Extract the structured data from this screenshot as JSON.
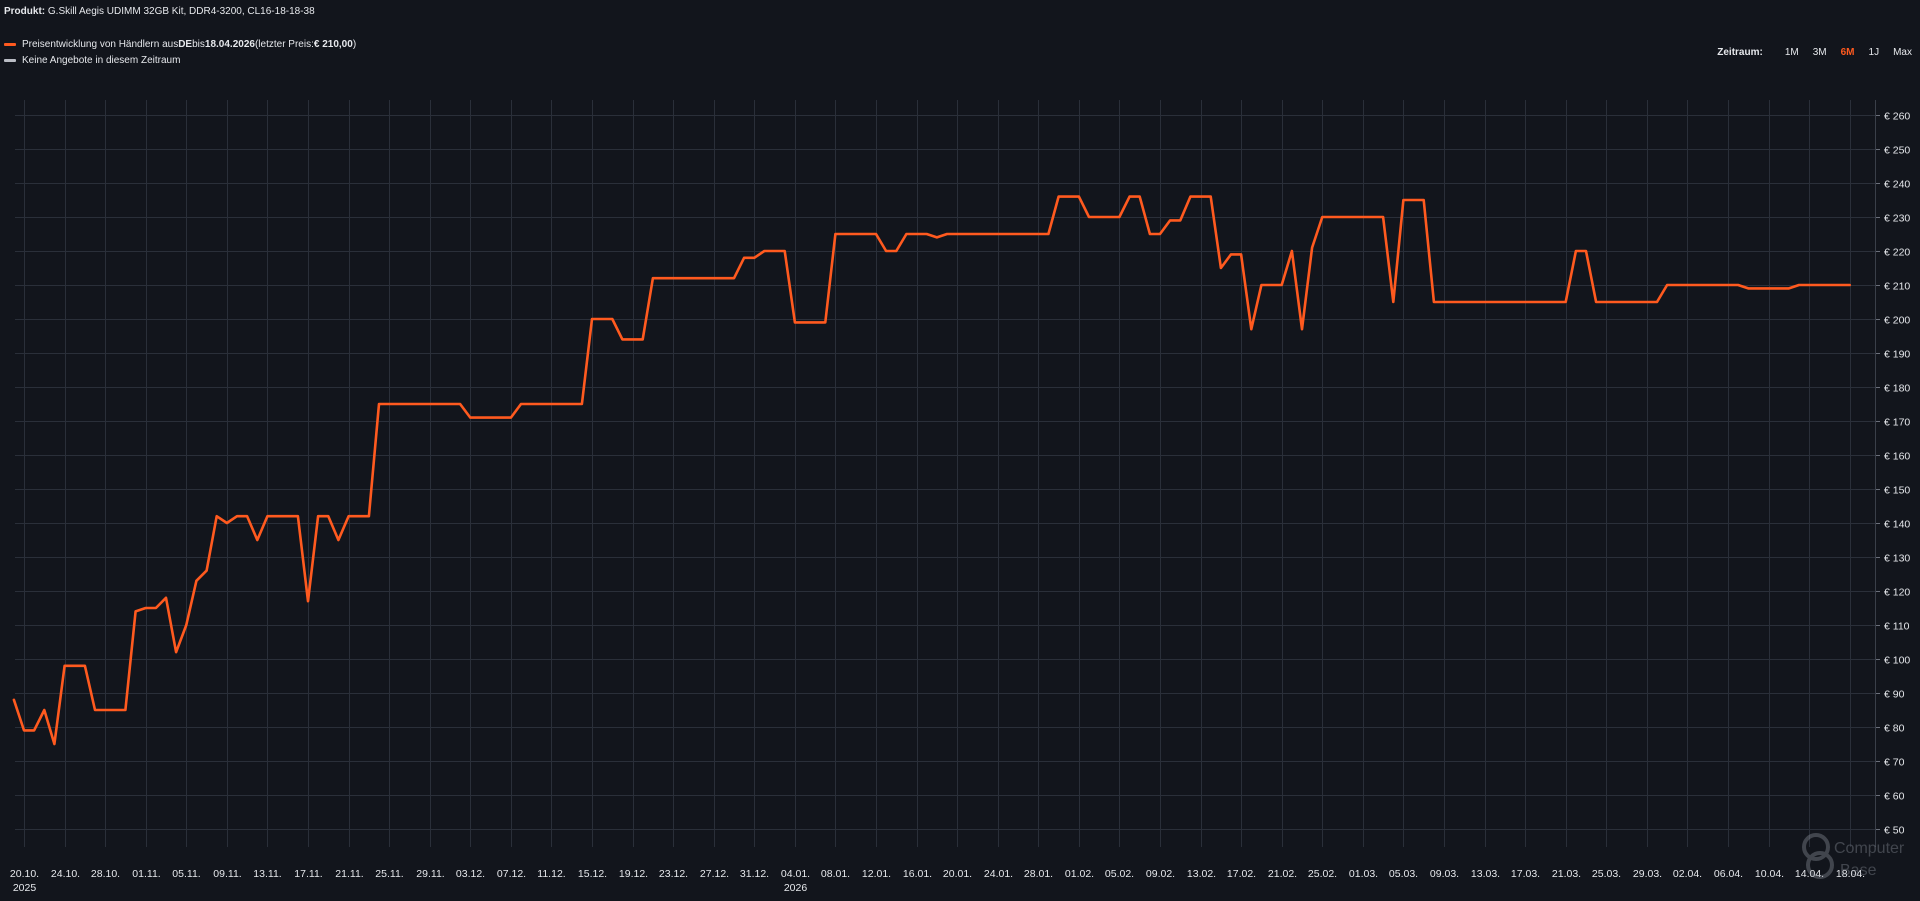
{
  "header": {
    "product_label": "Produkt:",
    "product_name": "G.Skill Aegis UDIMM 32GB Kit, DDR4-3200, CL16-18-18-38"
  },
  "legend": {
    "items": [
      {
        "color": "#ff5a1f",
        "text_prefix": "Preisentwicklung von Händlern aus ",
        "country": "DE",
        "text_mid": " bis ",
        "date": "18.04.2026",
        "text_last": " (letzter Preis: ",
        "last_price": "€ 210,00",
        "text_end": ")"
      },
      {
        "color": "#b9bcc4",
        "text": "Keine Angebote in diesem Zeitraum"
      }
    ]
  },
  "range": {
    "label": "Zeitraum:",
    "options": [
      "1M",
      "3M",
      "6M",
      "1J",
      "Max"
    ],
    "active": "6M",
    "active_color": "#ff5a1f"
  },
  "watermark": {
    "text1": "Computer",
    "text2": "Base"
  },
  "chart_data": {
    "type": "line",
    "xlabel": "",
    "ylabel": "",
    "ylim": [
      45,
      265
    ],
    "xlim": [
      "2025-10-20",
      "2026-04-20"
    ],
    "y_ticks": [
      50,
      60,
      70,
      80,
      90,
      100,
      110,
      120,
      130,
      140,
      150,
      160,
      170,
      180,
      190,
      200,
      210,
      220,
      230,
      240,
      250,
      260
    ],
    "y_tick_labels": [
      "€ 50",
      "€ 60",
      "€ 70",
      "€ 80",
      "€ 90",
      "€ 100",
      "€ 110",
      "€ 120",
      "€ 130",
      "€ 140",
      "€ 150",
      "€ 160",
      "€ 170",
      "€ 180",
      "€ 190",
      "€ 200",
      "€ 210",
      "€ 220",
      "€ 230",
      "€ 240",
      "€ 250",
      "€ 260"
    ],
    "x_ticks": [
      {
        "date": "2025-10-20",
        "label": "20.10.",
        "year": "2025"
      },
      {
        "date": "2025-10-24",
        "label": "24.10."
      },
      {
        "date": "2025-10-28",
        "label": "28.10."
      },
      {
        "date": "2025-11-01",
        "label": "01.11."
      },
      {
        "date": "2025-11-05",
        "label": "05.11."
      },
      {
        "date": "2025-11-09",
        "label": "09.11."
      },
      {
        "date": "2025-11-13",
        "label": "13.11."
      },
      {
        "date": "2025-11-17",
        "label": "17.11."
      },
      {
        "date": "2025-11-21",
        "label": "21.11."
      },
      {
        "date": "2025-11-25",
        "label": "25.11."
      },
      {
        "date": "2025-11-29",
        "label": "29.11."
      },
      {
        "date": "2025-12-03",
        "label": "03.12."
      },
      {
        "date": "2025-12-07",
        "label": "07.12."
      },
      {
        "date": "2025-12-11",
        "label": "11.12."
      },
      {
        "date": "2025-12-15",
        "label": "15.12."
      },
      {
        "date": "2025-12-19",
        "label": "19.12."
      },
      {
        "date": "2025-12-23",
        "label": "23.12."
      },
      {
        "date": "2025-12-27",
        "label": "27.12."
      },
      {
        "date": "2025-12-31",
        "label": "31.12."
      },
      {
        "date": "2026-01-04",
        "label": "04.01.",
        "year": "2026"
      },
      {
        "date": "2026-01-08",
        "label": "08.01."
      },
      {
        "date": "2026-01-12",
        "label": "12.01."
      },
      {
        "date": "2026-01-16",
        "label": "16.01."
      },
      {
        "date": "2026-01-20",
        "label": "20.01."
      },
      {
        "date": "2026-01-24",
        "label": "24.01."
      },
      {
        "date": "2026-01-28",
        "label": "28.01."
      },
      {
        "date": "2026-02-01",
        "label": "01.02."
      },
      {
        "date": "2026-02-05",
        "label": "05.02."
      },
      {
        "date": "2026-02-09",
        "label": "09.02."
      },
      {
        "date": "2026-02-13",
        "label": "13.02."
      },
      {
        "date": "2026-02-17",
        "label": "17.02."
      },
      {
        "date": "2026-02-21",
        "label": "21.02."
      },
      {
        "date": "2026-02-25",
        "label": "25.02."
      },
      {
        "date": "2026-03-01",
        "label": "01.03."
      },
      {
        "date": "2026-03-05",
        "label": "05.03."
      },
      {
        "date": "2026-03-09",
        "label": "09.03."
      },
      {
        "date": "2026-03-13",
        "label": "13.03."
      },
      {
        "date": "2026-03-17",
        "label": "17.03."
      },
      {
        "date": "2026-03-21",
        "label": "21.03."
      },
      {
        "date": "2026-03-25",
        "label": "25.03."
      },
      {
        "date": "2026-03-29",
        "label": "29.03."
      },
      {
        "date": "2026-04-02",
        "label": "02.04."
      },
      {
        "date": "2026-04-06",
        "label": "06.04."
      },
      {
        "date": "2026-04-10",
        "label": "10.04."
      },
      {
        "date": "2026-04-14",
        "label": "14.04."
      },
      {
        "date": "2026-04-18",
        "label": "18.04."
      }
    ],
    "grid": true,
    "series": [
      {
        "color": "#ff5a1f",
        "points": [
          [
            "2025-10-19T00:00",
            88
          ],
          [
            "2025-10-20T00:00",
            79
          ],
          [
            "2025-10-21T00:00",
            79
          ],
          [
            "2025-10-22T00:00",
            85
          ],
          [
            "2025-10-23T00:00",
            75
          ],
          [
            "2025-10-24T00:00",
            98
          ],
          [
            "2025-10-25T00:00",
            98
          ],
          [
            "2025-10-26T00:00",
            98
          ],
          [
            "2025-10-27T00:00",
            85
          ],
          [
            "2025-10-28T00:00",
            85
          ],
          [
            "2025-10-29T00:00",
            85
          ],
          [
            "2025-10-30T00:00",
            85
          ],
          [
            "2025-10-31T00:00",
            114
          ],
          [
            "2025-11-01T00:00",
            115
          ],
          [
            "2025-11-02T00:00",
            115
          ],
          [
            "2025-11-03T00:00",
            118
          ],
          [
            "2025-11-04T00:00",
            102
          ],
          [
            "2025-11-05T00:00",
            110
          ],
          [
            "2025-11-06T00:00",
            123
          ],
          [
            "2025-11-07T00:00",
            126
          ],
          [
            "2025-11-08T00:00",
            142
          ],
          [
            "2025-11-09T00:00",
            140
          ],
          [
            "2025-11-10T00:00",
            142
          ],
          [
            "2025-11-11T00:00",
            142
          ],
          [
            "2025-11-12T00:00",
            135
          ],
          [
            "2025-11-13T00:00",
            142
          ],
          [
            "2025-11-14T00:00",
            142
          ],
          [
            "2025-11-16T00:00",
            142
          ],
          [
            "2025-11-17T00:00",
            117
          ],
          [
            "2025-11-18T00:00",
            142
          ],
          [
            "2025-11-19T00:00",
            142
          ],
          [
            "2025-11-20T00:00",
            135
          ],
          [
            "2025-11-21T00:00",
            142
          ],
          [
            "2025-11-22T00:00",
            142
          ],
          [
            "2025-11-23T00:00",
            142
          ],
          [
            "2025-11-24T00:00",
            175
          ],
          [
            "2025-12-02T00:00",
            175
          ],
          [
            "2025-12-03T00:00",
            171
          ],
          [
            "2025-12-07T00:00",
            171
          ],
          [
            "2025-12-08T00:00",
            175
          ],
          [
            "2025-12-14T00:00",
            175
          ],
          [
            "2025-12-15T00:00",
            200
          ],
          [
            "2025-12-17T00:00",
            200
          ],
          [
            "2025-12-18T00:00",
            194
          ],
          [
            "2025-12-20T00:00",
            194
          ],
          [
            "2025-12-21T00:00",
            212
          ],
          [
            "2025-12-29T00:00",
            212
          ],
          [
            "2025-12-30T00:00",
            218
          ],
          [
            "2025-12-31T00:00",
            218
          ],
          [
            "2026-01-01T00:00",
            220
          ],
          [
            "2026-01-03T00:00",
            220
          ],
          [
            "2026-01-04T00:00",
            199
          ],
          [
            "2026-01-07T00:00",
            199
          ],
          [
            "2026-01-08T00:00",
            225
          ],
          [
            "2026-01-12T00:00",
            225
          ],
          [
            "2026-01-13T00:00",
            220
          ],
          [
            "2026-01-14T00:00",
            220
          ],
          [
            "2026-01-15T00:00",
            225
          ],
          [
            "2026-01-17T00:00",
            225
          ],
          [
            "2026-01-18T00:00",
            224
          ],
          [
            "2026-01-19T00:00",
            225
          ],
          [
            "2026-01-28T00:00",
            225
          ],
          [
            "2026-01-29T00:00",
            225
          ],
          [
            "2026-01-30T00:00",
            236
          ],
          [
            "2026-02-01T00:00",
            236
          ],
          [
            "2026-02-02T00:00",
            230
          ],
          [
            "2026-02-05T00:00",
            230
          ],
          [
            "2026-02-06T00:00",
            236
          ],
          [
            "2026-02-07T00:00",
            236
          ],
          [
            "2026-02-08T00:00",
            225
          ],
          [
            "2026-02-09T00:00",
            225
          ],
          [
            "2026-02-10T00:00",
            229
          ],
          [
            "2026-02-11T00:00",
            229
          ],
          [
            "2026-02-12T00:00",
            236
          ],
          [
            "2026-02-14T00:00",
            236
          ],
          [
            "2026-02-15T00:00",
            215
          ],
          [
            "2026-02-16T00:00",
            219
          ],
          [
            "2026-02-17T00:00",
            219
          ],
          [
            "2026-02-18T00:00",
            197
          ],
          [
            "2026-02-19T00:00",
            210
          ],
          [
            "2026-02-21T00:00",
            210
          ],
          [
            "2026-02-22T00:00",
            220
          ],
          [
            "2026-02-23T00:00",
            197
          ],
          [
            "2026-02-24T00:00",
            221
          ],
          [
            "2026-02-25T00:00",
            230
          ],
          [
            "2026-03-03T00:00",
            230
          ],
          [
            "2026-03-04T00:00",
            205
          ],
          [
            "2026-03-05T00:00",
            235
          ],
          [
            "2026-03-07T00:00",
            235
          ],
          [
            "2026-03-08T00:00",
            205
          ],
          [
            "2026-03-21T00:00",
            205
          ],
          [
            "2026-03-22T00:00",
            220
          ],
          [
            "2026-03-23T00:00",
            220
          ],
          [
            "2026-03-24T00:00",
            205
          ],
          [
            "2026-03-30T00:00",
            205
          ],
          [
            "2026-03-31T00:00",
            210
          ],
          [
            "2026-04-07T00:00",
            210
          ],
          [
            "2026-04-08T00:00",
            209
          ],
          [
            "2026-04-12T00:00",
            209
          ],
          [
            "2026-04-13T00:00",
            210
          ],
          [
            "2026-04-18T00:00",
            210
          ]
        ]
      }
    ]
  }
}
